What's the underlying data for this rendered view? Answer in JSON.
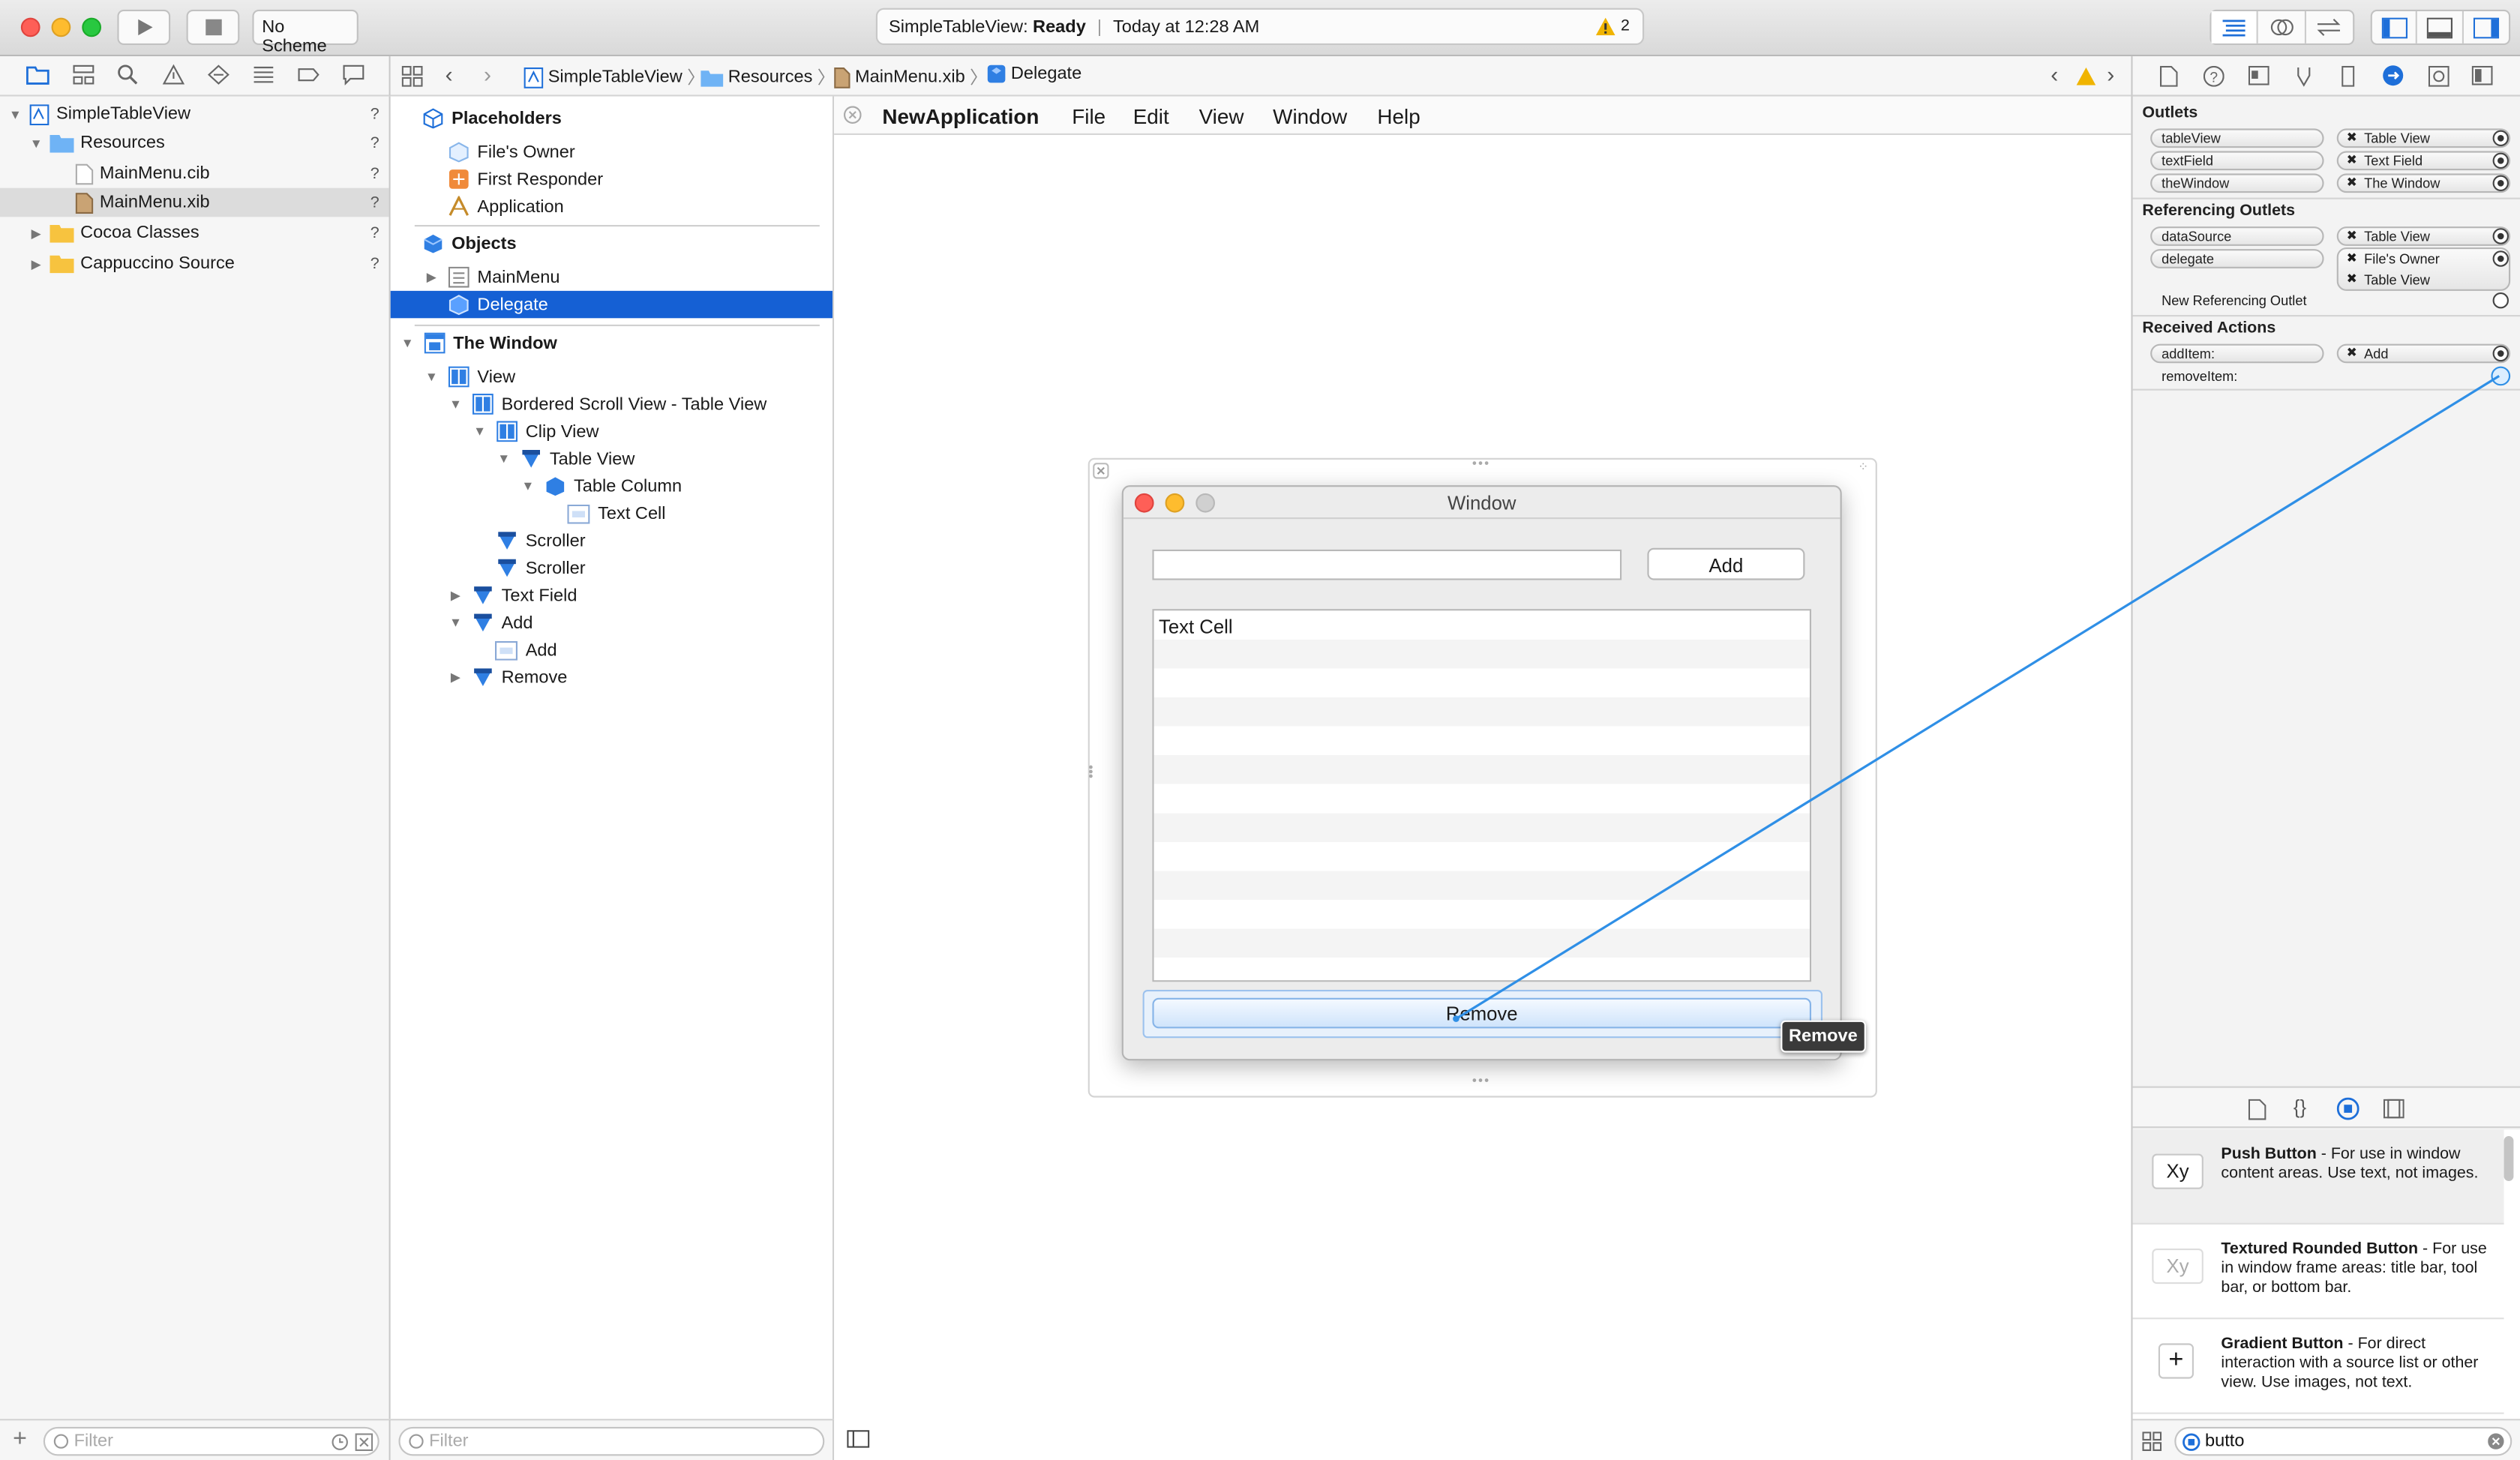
{
  "toolbar": {
    "scheme": "No Scheme",
    "activity_project": "SimpleTableView:",
    "activity_status": "Ready",
    "activity_time": "Today at 12:28 AM",
    "warning_count": "2"
  },
  "navigator": {
    "items": [
      {
        "label": "SimpleTableView",
        "status": "?"
      },
      {
        "label": "Resources",
        "status": "?"
      },
      {
        "label": "MainMenu.cib",
        "status": "?"
      },
      {
        "label": "MainMenu.xib",
        "status": "?"
      },
      {
        "label": "Cocoa Classes",
        "status": "?"
      },
      {
        "label": "Cappuccino Source",
        "status": "?"
      }
    ],
    "filter_placeholder": "Filter"
  },
  "jumpbar": {
    "crumbs": [
      "SimpleTableView",
      "Resources",
      "MainMenu.xib",
      "Delegate"
    ]
  },
  "outline": {
    "placeholders_header": "Placeholders",
    "placeholders": [
      "File's Owner",
      "First Responder",
      "Application"
    ],
    "objects_header": "Objects",
    "objects": [
      "MainMenu",
      "Delegate"
    ],
    "window_header": "The Window",
    "tree": [
      "View",
      "Bordered Scroll View - Table View",
      "Clip View",
      "Table View",
      "Table Column",
      "Text Cell",
      "Scroller",
      "Scroller",
      "Text Field",
      "Add",
      "Add",
      "Remove"
    ],
    "filter_placeholder": "Filter"
  },
  "canvas": {
    "menu": [
      "NewApplication",
      "File",
      "Edit",
      "View",
      "Window",
      "Help"
    ],
    "window_title": "Window",
    "add_button": "Add",
    "table_first_cell": "Text Cell",
    "remove_button": "Remove",
    "drag_tooltip": "Remove"
  },
  "inspector": {
    "outlets_header": "Outlets",
    "outlets": [
      {
        "name": "tableView",
        "target": "Table View"
      },
      {
        "name": "textField",
        "target": "Text Field"
      },
      {
        "name": "theWindow",
        "target": "The Window"
      }
    ],
    "ref_header": "Referencing Outlets",
    "ref_outlets": [
      {
        "name": "dataSource",
        "targets": [
          "Table View"
        ]
      },
      {
        "name": "delegate",
        "targets": [
          "File's Owner",
          "Table View"
        ]
      }
    ],
    "new_ref": "New Referencing Outlet",
    "actions_header": "Received Actions",
    "actions": [
      {
        "name": "addItem:",
        "target": "Add"
      },
      {
        "name": "removeItem:",
        "target": ""
      }
    ]
  },
  "library": {
    "items": [
      {
        "icon": "Xy",
        "title": "Push Button",
        "desc": " - For use in window content areas. Use text, not images."
      },
      {
        "icon": "Xy",
        "title": "Textured Rounded Button",
        "desc": " - For use in window frame areas: title bar, tool bar, or bottom bar."
      },
      {
        "icon": "+",
        "title": "Gradient Button",
        "desc": " - For direct interaction with a source list or other view. Use images, not text."
      }
    ],
    "search_value": "butto"
  },
  "colors": {
    "selection": "#1560d4",
    "connection": "#2f8fe6"
  }
}
